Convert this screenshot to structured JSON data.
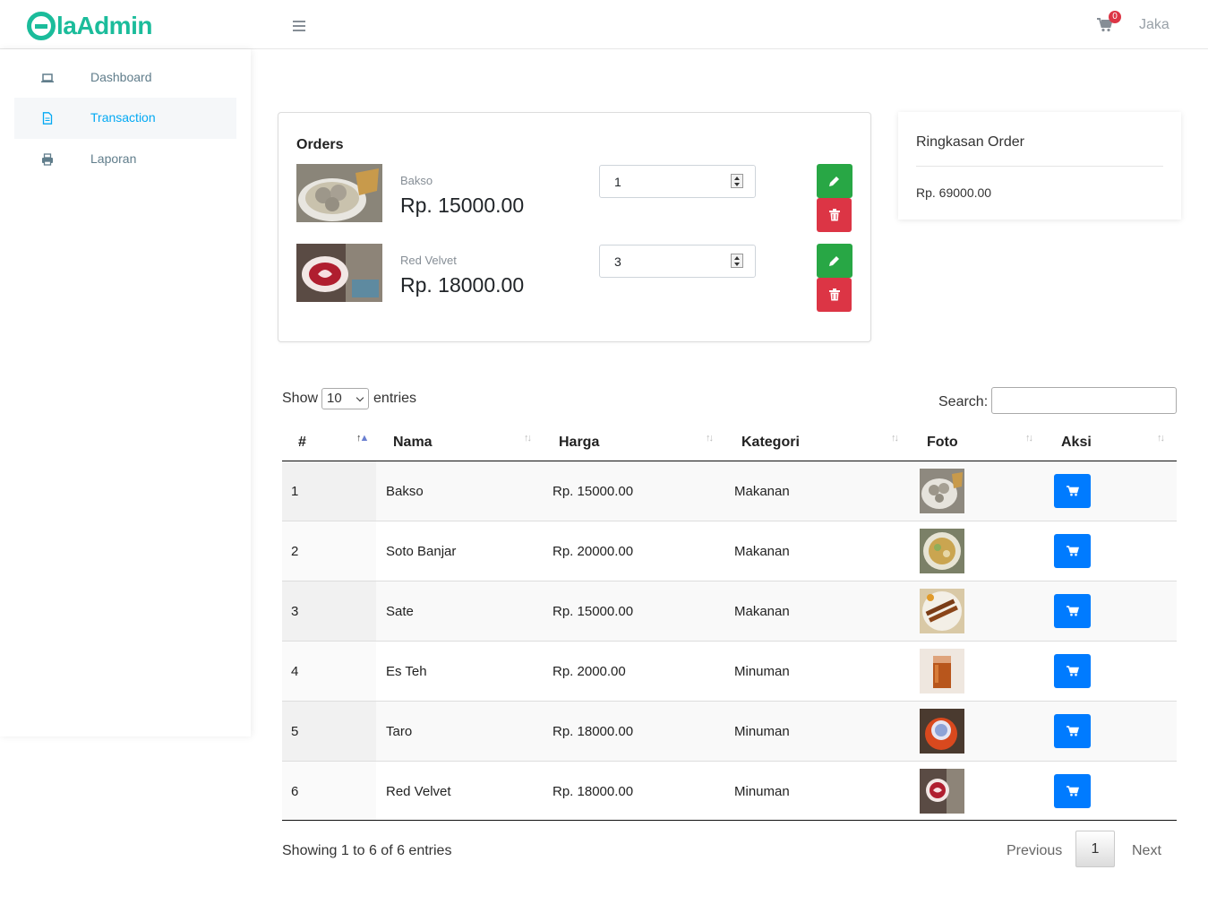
{
  "brand": {
    "logo_text": "laAdmin"
  },
  "header": {
    "cart_count": "0",
    "user_name": "Jaka"
  },
  "sidebar": {
    "items": [
      {
        "label": "Dashboard",
        "icon": "laptop-icon"
      },
      {
        "label": "Transaction",
        "icon": "file-icon"
      },
      {
        "label": "Laporan",
        "icon": "printer-icon"
      }
    ]
  },
  "orders": {
    "title": "Orders",
    "items": [
      {
        "name": "Bakso",
        "price": "Rp. 15000.00",
        "qty": "1"
      },
      {
        "name": "Red Velvet",
        "price": "Rp. 18000.00",
        "qty": "3"
      }
    ]
  },
  "summary": {
    "title": "Ringkasan Order",
    "total": "Rp. 69000.00"
  },
  "datatable": {
    "show_label": "Show",
    "length_value": "10",
    "entries_label": "entries",
    "search_label": "Search:",
    "columns": [
      "#",
      "Nama",
      "Harga",
      "Kategori",
      "Foto",
      "Aksi"
    ],
    "rows": [
      {
        "no": "1",
        "nama": "Bakso",
        "harga": "Rp. 15000.00",
        "kategori": "Makanan"
      },
      {
        "no": "2",
        "nama": "Soto Banjar",
        "harga": "Rp. 20000.00",
        "kategori": "Makanan"
      },
      {
        "no": "3",
        "nama": "Sate",
        "harga": "Rp. 15000.00",
        "kategori": "Makanan"
      },
      {
        "no": "4",
        "nama": "Es Teh",
        "harga": "Rp. 2000.00",
        "kategori": "Minuman"
      },
      {
        "no": "5",
        "nama": "Taro",
        "harga": "Rp. 18000.00",
        "kategori": "Minuman"
      },
      {
        "no": "6",
        "nama": "Red Velvet",
        "harga": "Rp. 18000.00",
        "kategori": "Minuman"
      }
    ],
    "info": "Showing 1 to 6 of 6 entries",
    "prev": "Previous",
    "page": "1",
    "next": "Next"
  },
  "colors": {
    "brand": "#1bbc9b",
    "active_nav": "#03a9f3",
    "edit": "#28a745",
    "delete": "#dc3545",
    "cart": "#007bff"
  }
}
